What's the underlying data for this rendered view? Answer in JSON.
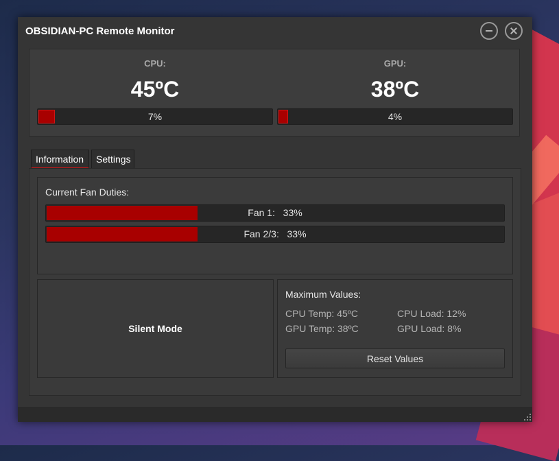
{
  "window": {
    "title": "OBSIDIAN-PC Remote Monitor"
  },
  "cpu": {
    "label": "CPU:",
    "temperature": "45ºC",
    "load_text": "7%",
    "load_fraction": 0.07
  },
  "gpu": {
    "label": "GPU:",
    "temperature": "38ºC",
    "load_text": "4%",
    "load_fraction": 0.04
  },
  "tabs": [
    {
      "label": "Information",
      "active": true
    },
    {
      "label": "Settings",
      "active": false
    }
  ],
  "fans": {
    "title": "Current Fan Duties:",
    "items": [
      {
        "text": "Fan 1:   33%",
        "duty_fraction": 0.33
      },
      {
        "text": "Fan 2/3:   33%",
        "duty_fraction": 0.33
      }
    ]
  },
  "mode": {
    "label": "Silent Mode"
  },
  "max_values": {
    "title": "Maximum Values:",
    "cpu_temp": "CPU Temp: 45ºC",
    "gpu_temp": "GPU Temp: 38ºC",
    "cpu_load": "CPU Load: 12%",
    "gpu_load": "GPU Load: 8%",
    "reset_label": "Reset Values"
  },
  "colors": {
    "accent_red": "#a80000",
    "window_bg": "#353535"
  }
}
